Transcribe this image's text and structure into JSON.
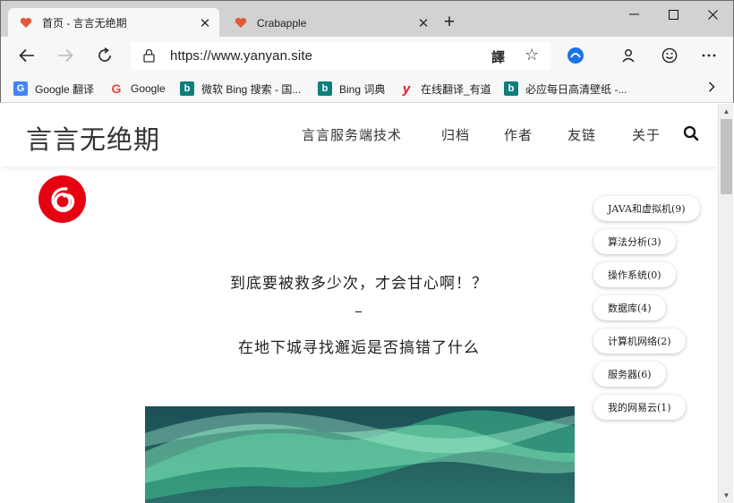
{
  "browser": {
    "tabs": [
      {
        "title": "首页 - 言言无绝期",
        "close": "✕"
      },
      {
        "title": "Crabapple",
        "close": "✕"
      }
    ],
    "new_tab": "+",
    "address": {
      "url": "https://www.yanyan.site",
      "translate_glyph": "譯"
    },
    "favorites": [
      {
        "label": "Google 翻译",
        "icon": "google-translate-icon",
        "color": "#4285f4"
      },
      {
        "label": "Google",
        "icon": "google-icon",
        "color": "#ea4335"
      },
      {
        "label": "微软 Bing 搜索 - 国...",
        "icon": "bing-icon",
        "color": "#0f7e7b"
      },
      {
        "label": "Bing 词典",
        "icon": "bing-icon",
        "color": "#0f7e7b"
      },
      {
        "label": "在线翻译_有道",
        "icon": "youdao-icon",
        "color": "#e3162d"
      },
      {
        "label": "必应每日高清壁纸 -...",
        "icon": "bing-icon",
        "color": "#0f7e7b"
      }
    ]
  },
  "site": {
    "title": "言言无绝期",
    "nav": [
      "言言服务端技术",
      "归档",
      "作者",
      "友链",
      "关于"
    ],
    "quote_lines": [
      "到底要被救多少次，才会甘心啊！？",
      "–",
      "在地下城寻找邂逅是否搞错了什么"
    ],
    "categories": [
      {
        "label": "JAVA和虚拟机(9)"
      },
      {
        "label": "算法分析(3)"
      },
      {
        "label": "操作系统(0)"
      },
      {
        "label": "数据库(4)"
      },
      {
        "label": "计算机网络(2)"
      },
      {
        "label": "服务器(6)"
      },
      {
        "label": "我的网易云(1)"
      }
    ],
    "accent": "#e60012"
  }
}
